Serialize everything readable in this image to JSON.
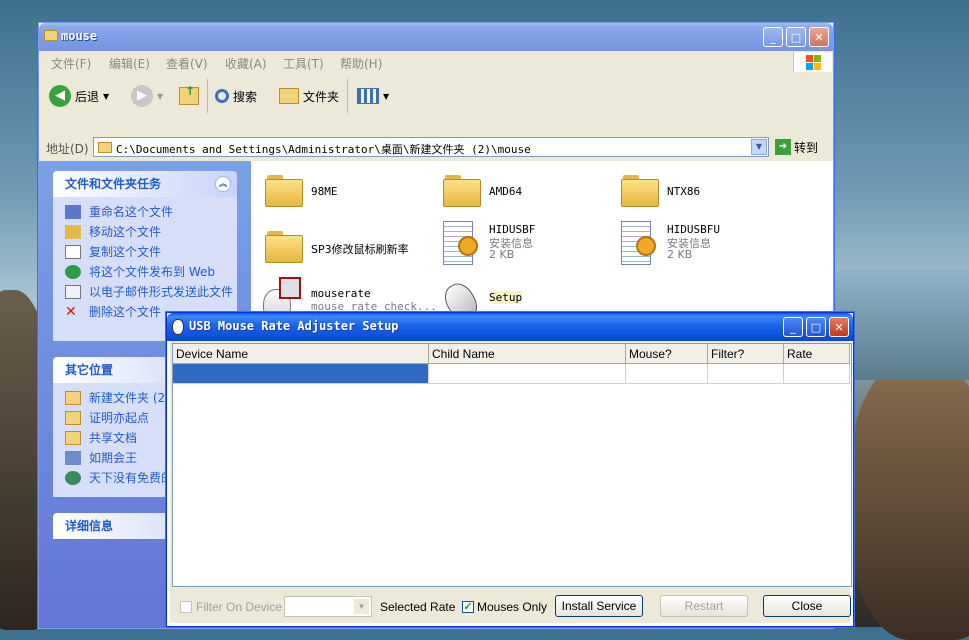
{
  "explorer": {
    "title": "mouse",
    "menu": [
      "文件(F)",
      "编辑(E)",
      "查看(V)",
      "收藏(A)",
      "工具(T)",
      "帮助(H)"
    ],
    "toolbar": {
      "back": "后退",
      "search": "搜索",
      "folders": "文件夹"
    },
    "address": {
      "label": "地址(D)",
      "path": "C:\\Documents and Settings\\Administrator\\桌面\\新建文件夹 (2)\\mouse",
      "go": "转到"
    },
    "tasks": {
      "title": "文件和文件夹任务",
      "items": [
        "重命名这个文件",
        "移动这个文件",
        "复制这个文件",
        "将这个文件发布到 Web",
        "以电子邮件形式发送此文件",
        "删除这个文件"
      ]
    },
    "other_places": {
      "title": "其它位置",
      "items": [
        "新建文件夹 (2",
        "证明亦起点",
        "共享文档",
        "如期会王",
        "天下没有免费的"
      ]
    },
    "details": {
      "title": "详细信息"
    },
    "files": [
      {
        "name": "98ME",
        "type": "folder"
      },
      {
        "name": "AMD64",
        "type": "folder"
      },
      {
        "name": "NTX86",
        "type": "folder"
      },
      {
        "name": "SP3修改鼠标刷新率",
        "type": "folder"
      },
      {
        "name": "HIDUSBF",
        "sub1": "安装信息",
        "sub2": "2 KB",
        "type": "inf"
      },
      {
        "name": "HIDUSBFU",
        "sub1": "安装信息",
        "sub2": "2 KB",
        "type": "inf"
      },
      {
        "name": "mouserate",
        "sub1": "mouse rate check...",
        "type": "app"
      },
      {
        "name": "Setup",
        "type": "mouse-app"
      }
    ]
  },
  "dialog": {
    "title": "USB Mouse Rate Adjuster Setup",
    "columns": [
      "Device Name",
      "Child Name",
      "Mouse?",
      "Filter?",
      "Rate"
    ],
    "filter_label": "Filter On Device",
    "selected_rate_label": "Selected Rate",
    "mouses_only_label": "Mouses Only",
    "mouses_only_checked": true,
    "install_label": "Install Service",
    "restart_label": "Restart",
    "close_label": "Close"
  }
}
